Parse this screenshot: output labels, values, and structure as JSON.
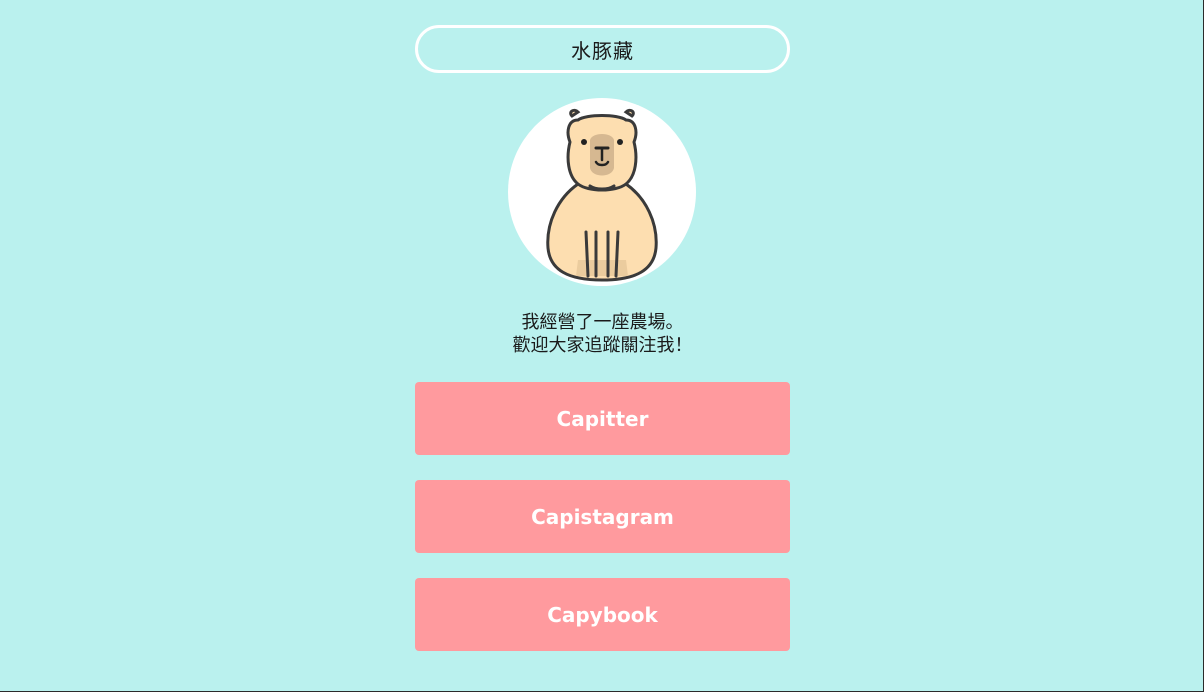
{
  "profile": {
    "name": "水豚藏",
    "bio_line1": "我經營了一座農場。",
    "bio_line2": "歡迎大家追蹤關注我！"
  },
  "links": [
    {
      "label": "Capitter"
    },
    {
      "label": "Capistagram"
    },
    {
      "label": "Capybook"
    }
  ],
  "colors": {
    "background": "#baf1ee",
    "button": "#ff9a9e",
    "button_text": "#ffffff",
    "avatar_bg": "#ffffff"
  },
  "icons": {
    "avatar": "capybara-icon"
  }
}
